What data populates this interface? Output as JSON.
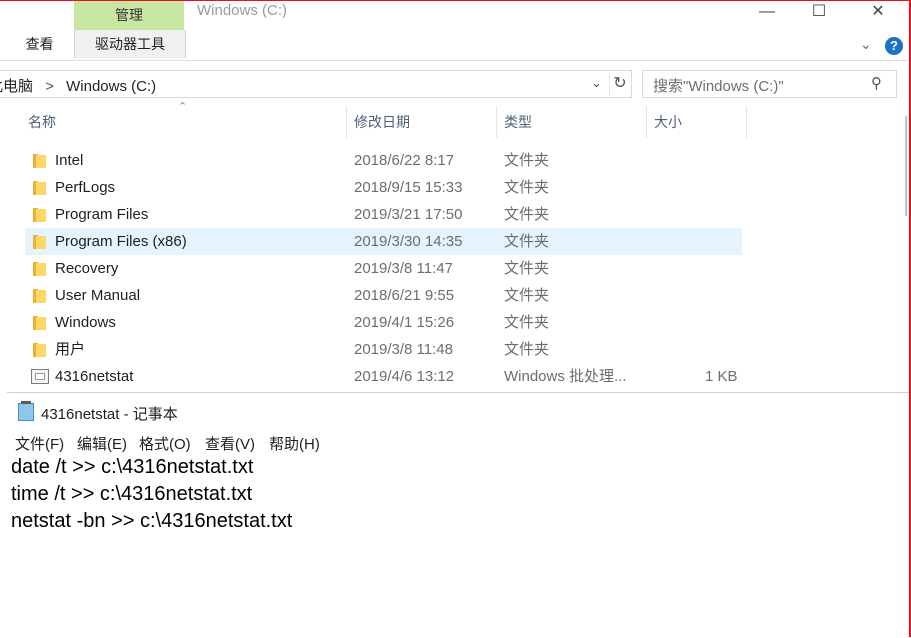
{
  "explorer": {
    "title": "Windows (C:)",
    "ribbon": {
      "manage_tab": "管理",
      "drive_tools_tab": "驱动器工具",
      "view_tab": "查看",
      "help": "?"
    },
    "address": {
      "crumb_prefix": "此电脑",
      "separator": ">",
      "crumb": "Windows (C:)"
    },
    "search_placeholder": "搜索\"Windows (C:)\"",
    "columns": {
      "name": "名称",
      "date": "修改日期",
      "type": "类型",
      "size": "大小"
    },
    "files": [
      {
        "name": "Intel",
        "date": "2018/6/22 8:17",
        "type": "文件夹",
        "size": "",
        "icon": "folder-icon"
      },
      {
        "name": "PerfLogs",
        "date": "2018/9/15 15:33",
        "type": "文件夹",
        "size": "",
        "icon": "folder-icon"
      },
      {
        "name": "Program Files",
        "date": "2019/3/21 17:50",
        "type": "文件夹",
        "size": "",
        "icon": "folder-icon"
      },
      {
        "name": "Program Files (x86)",
        "date": "2019/3/30 14:35",
        "type": "文件夹",
        "size": "",
        "icon": "folder-icon",
        "selected": true
      },
      {
        "name": "Recovery",
        "date": "2019/3/8 11:47",
        "type": "文件夹",
        "size": "",
        "icon": "folder-icon"
      },
      {
        "name": "User Manual",
        "date": "2018/6/21 9:55",
        "type": "文件夹",
        "size": "",
        "icon": "folder-icon"
      },
      {
        "name": "Windows",
        "date": "2019/4/1 15:26",
        "type": "文件夹",
        "size": "",
        "icon": "folder-icon"
      },
      {
        "name": "用户",
        "date": "2019/3/8 11:48",
        "type": "文件夹",
        "size": "",
        "icon": "folder-icon"
      },
      {
        "name": "4316netstat",
        "date": "2019/4/6 13:12",
        "type": "Windows 批处理...",
        "size": "1 KB",
        "icon": "batch-file-icon"
      }
    ]
  },
  "notepad": {
    "title": "4316netstat - 记事本",
    "menu": [
      "文件(F)",
      "编辑(E)",
      "格式(O)",
      "查看(V)",
      "帮助(H)"
    ],
    "lines": [
      "date /t >> c:\\4316netstat.txt",
      "time /t >> c:\\4316netstat.txt",
      "netstat -bn >> c:\\4316netstat.txt"
    ]
  },
  "colors": {
    "manage_tab_bg": "#c7e6a1",
    "selection_bg": "#e5f3ff",
    "window_border": "#e81123",
    "help_blue": "#1a73c9"
  }
}
